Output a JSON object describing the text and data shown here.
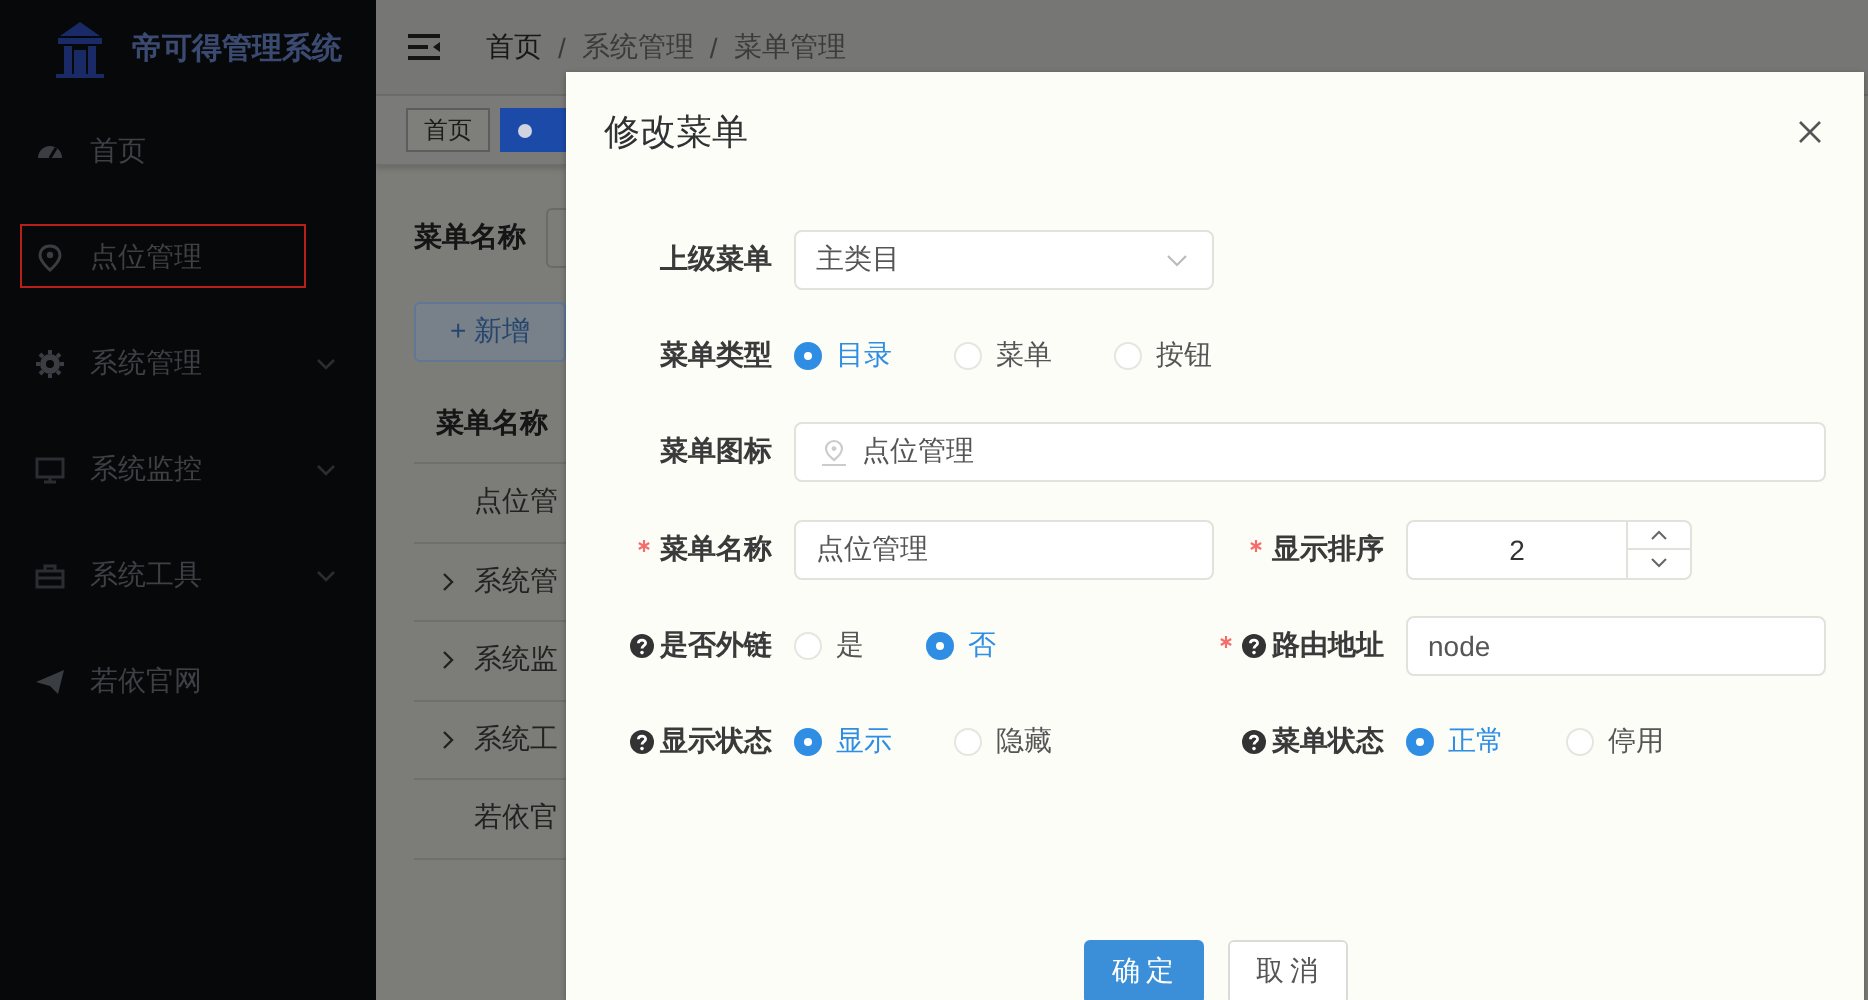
{
  "app": {
    "title": "帝可得管理系统"
  },
  "sidebar": {
    "items": [
      {
        "label": "首页",
        "expandable": false,
        "highlighted": false
      },
      {
        "label": "点位管理",
        "expandable": false,
        "highlighted": true
      },
      {
        "label": "系统管理",
        "expandable": true,
        "highlighted": false
      },
      {
        "label": "系统监控",
        "expandable": true,
        "highlighted": false
      },
      {
        "label": "系统工具",
        "expandable": true,
        "highlighted": false
      },
      {
        "label": "若依官网",
        "expandable": false,
        "highlighted": false
      }
    ]
  },
  "breadcrumb": [
    {
      "label": "首页"
    },
    {
      "separator": "/",
      "label": "系统管理"
    },
    {
      "separator": "/",
      "label": "菜单管理"
    }
  ],
  "tags": [
    {
      "label": "首页",
      "selected": false
    },
    {
      "selected": true
    }
  ],
  "search": {
    "label": "菜单名称"
  },
  "add_button": "+ 新增",
  "table": {
    "columns": [
      "菜单名称"
    ],
    "rows": [
      {
        "name": "点位管",
        "expandable": false
      },
      {
        "name": "系统管",
        "expandable": true
      },
      {
        "name": "系统监",
        "expandable": true
      },
      {
        "name": "系统工",
        "expandable": true
      },
      {
        "name": "若依官",
        "expandable": false
      }
    ]
  },
  "dialog": {
    "title": "修改菜单",
    "rows": [
      {
        "fields": [
          {
            "kind": "select",
            "label": "上级菜单",
            "value": "主类目",
            "required": false,
            "help": false
          }
        ]
      },
      {
        "fields": [
          {
            "kind": "radio",
            "label": "菜单类型",
            "required": false,
            "help": false,
            "options": [
              {
                "label": "目录",
                "selected": true
              },
              {
                "label": "菜单",
                "selected": false
              },
              {
                "label": "按钮",
                "selected": false
              }
            ]
          }
        ]
      },
      {
        "fields": [
          {
            "kind": "icon-input",
            "label": "菜单图标",
            "value": "点位管理",
            "required": false,
            "help": false
          }
        ]
      },
      {
        "fields": [
          {
            "kind": "input",
            "label": "菜单名称",
            "value": "点位管理",
            "required": true,
            "help": false
          },
          {
            "kind": "number",
            "label": "显示排序",
            "value": "2",
            "required": true,
            "help": false
          }
        ]
      },
      {
        "fields": [
          {
            "kind": "radio",
            "label": "是否外链",
            "required": false,
            "help": true,
            "options": [
              {
                "label": "是",
                "selected": false
              },
              {
                "label": "否",
                "selected": true
              }
            ]
          },
          {
            "kind": "input",
            "label": "路由地址",
            "value": "node",
            "required": true,
            "help": true
          }
        ]
      },
      {
        "fields": [
          {
            "kind": "radio",
            "label": "显示状态",
            "required": false,
            "help": true,
            "options": [
              {
                "label": "显示",
                "selected": true
              },
              {
                "label": "隐藏",
                "selected": false
              }
            ]
          },
          {
            "kind": "radio",
            "label": "菜单状态",
            "required": false,
            "help": true,
            "options": [
              {
                "label": "正常",
                "selected": true
              },
              {
                "label": "停用",
                "selected": false
              }
            ]
          }
        ]
      }
    ],
    "buttons": [
      {
        "label": "确定",
        "kind": "primary"
      },
      {
        "label": "取消",
        "kind": "default"
      }
    ]
  }
}
